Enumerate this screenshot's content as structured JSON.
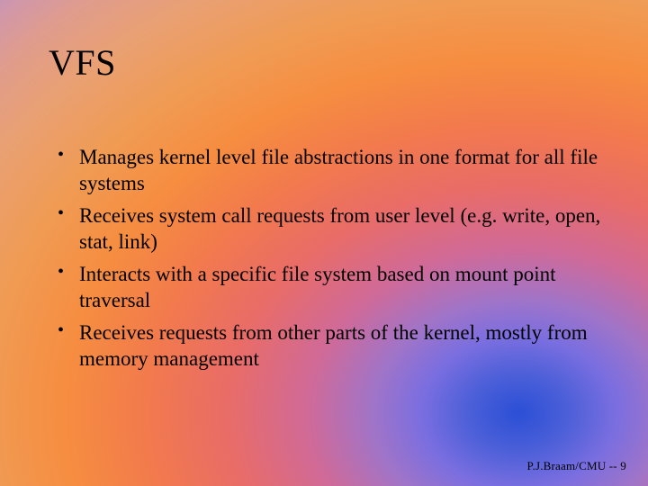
{
  "title": "VFS",
  "bullets": [
    "Manages kernel level file abstractions in one format for all file systems",
    "Receives system call requests from user level (e.g. write, open, stat, link)",
    "Interacts with a specific file system based on mount point traversal",
    "Receives requests from other parts of the kernel, mostly from memory management"
  ],
  "footer": "P.J.Braam/CMU  -- 9"
}
